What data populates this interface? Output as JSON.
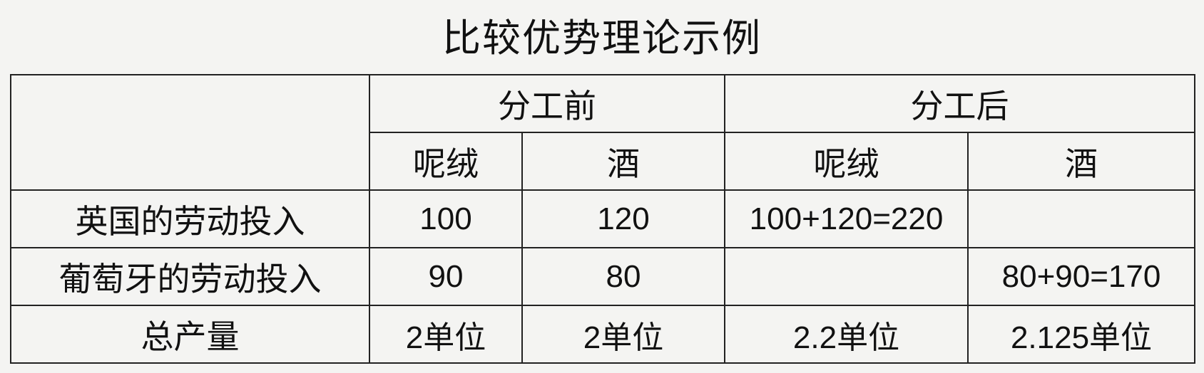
{
  "title": "比较优势理论示例",
  "table": {
    "group_headers": [
      "分工前",
      "分工后"
    ],
    "sub_headers": [
      "呢绒",
      "酒",
      "呢绒",
      "酒"
    ],
    "rows": [
      {
        "label": "英国的劳动投入",
        "cells": [
          "100",
          "120",
          "100+120=220",
          ""
        ]
      },
      {
        "label": "葡萄牙的劳动投入",
        "cells": [
          "90",
          "80",
          "",
          "80+90=170"
        ]
      },
      {
        "label": "总产量",
        "cells": [
          "2单位",
          "2单位",
          "2.2单位",
          "2.125单位"
        ]
      }
    ]
  }
}
